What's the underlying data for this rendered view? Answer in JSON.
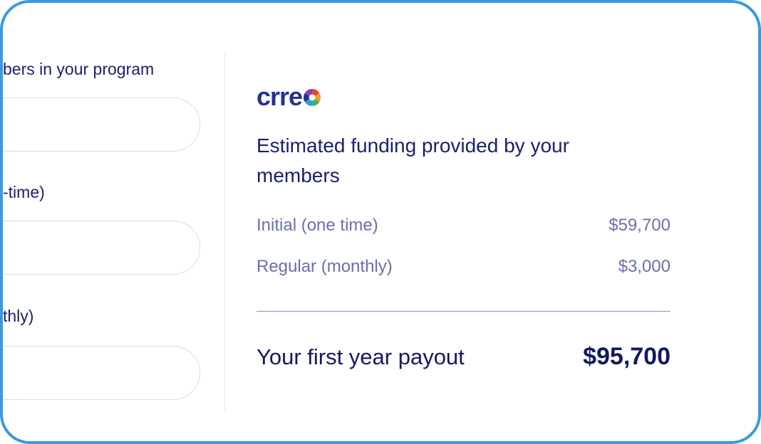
{
  "form": {
    "members_label": "bers in your program",
    "initial_label": "-time)",
    "monthly_label": "thly)"
  },
  "brand": {
    "logo_text": "crre",
    "icon": "aperture-wheel-icon",
    "colors": {
      "border": "#3a9ad9",
      "text_primary": "#1b1f6e",
      "text_secondary": "#6a6fae",
      "logo_blue": "#24338f"
    }
  },
  "summary": {
    "heading": "Estimated funding provided by your members",
    "rows": [
      {
        "label": "Initial (one time)",
        "value": "$59,700"
      },
      {
        "label": "Regular (monthly)",
        "value": "$3,000"
      }
    ],
    "total_label": "Your first year payout",
    "total_value": "$95,700"
  }
}
